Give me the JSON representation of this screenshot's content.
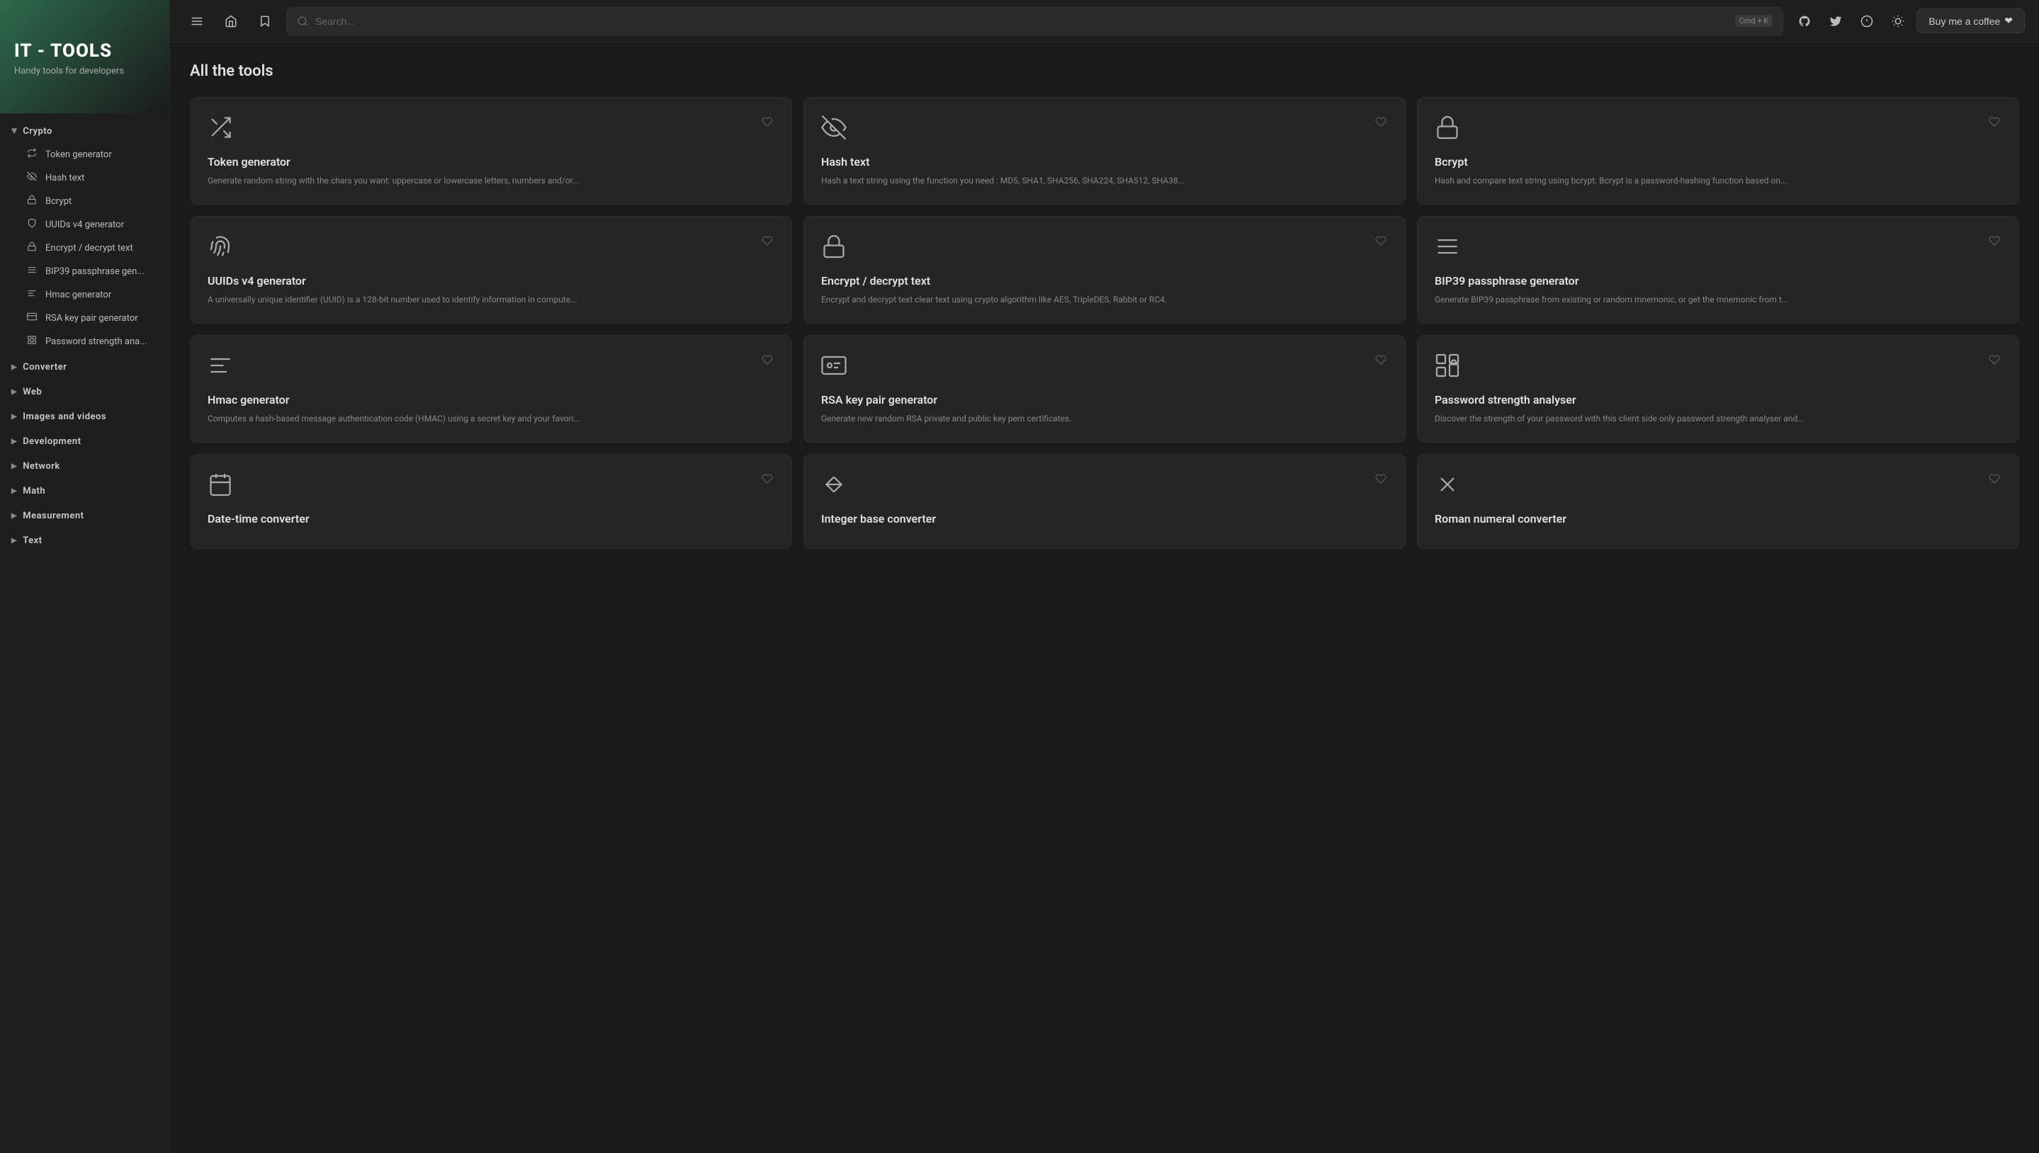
{
  "sidebar": {
    "title": "IT - TOOLS",
    "subtitle": "Handy tools for developers",
    "sections": [
      {
        "id": "crypto",
        "label": "Crypto",
        "open": true,
        "items": [
          {
            "id": "token-generator",
            "label": "Token generator",
            "icon": "⇄"
          },
          {
            "id": "hash-text",
            "label": "Hash text",
            "icon": "◎"
          },
          {
            "id": "bcrypt",
            "label": "Bcrypt",
            "icon": "▦"
          },
          {
            "id": "uuids-v4",
            "label": "UUIDs v4 generator",
            "icon": "◌"
          },
          {
            "id": "encrypt-decrypt",
            "label": "Encrypt / decrypt text",
            "icon": "🔒"
          },
          {
            "id": "bip39",
            "label": "BIP39 passphrase gen...",
            "icon": "≡"
          },
          {
            "id": "hmac",
            "label": "Hmac generator",
            "icon": "≡"
          },
          {
            "id": "rsa-key",
            "label": "RSA key pair generator",
            "icon": "▦"
          },
          {
            "id": "password-strength",
            "label": "Password strength ana...",
            "icon": "▦"
          }
        ]
      },
      {
        "id": "converter",
        "label": "Converter",
        "open": false,
        "items": []
      },
      {
        "id": "web",
        "label": "Web",
        "open": false,
        "items": []
      },
      {
        "id": "images-and-videos",
        "label": "Images and videos",
        "open": false,
        "items": []
      },
      {
        "id": "development",
        "label": "Development",
        "open": false,
        "items": []
      },
      {
        "id": "network",
        "label": "Network",
        "open": false,
        "items": []
      },
      {
        "id": "math",
        "label": "Math",
        "open": false,
        "items": []
      },
      {
        "id": "measurement",
        "label": "Measurement",
        "open": false,
        "items": []
      },
      {
        "id": "text",
        "label": "Text",
        "open": false,
        "items": []
      }
    ]
  },
  "topbar": {
    "search_placeholder": "Search...",
    "search_shortcut": "Cmd + K",
    "buy_coffee_label": "Buy me a coffee",
    "buy_coffee_icon": "☕"
  },
  "content": {
    "title": "All the tools",
    "tools": [
      {
        "id": "token-generator",
        "name": "Token generator",
        "desc": "Generate random string with the chars you want: uppercase or lowercase letters, numbers and/or...",
        "icon": "shuffle"
      },
      {
        "id": "hash-text",
        "name": "Hash text",
        "desc": "Hash a text string using the function you need : MD5, SHA1, SHA256, SHA224, SHA512, SHA38...",
        "icon": "eye-off"
      },
      {
        "id": "bcrypt",
        "name": "Bcrypt",
        "desc": "Hash and compare text string using bcrypt. Bcrypt is a password-hashing function based on...",
        "icon": "lock"
      },
      {
        "id": "uuids-v4",
        "name": "UUIDs v4 generator",
        "desc": "A universally unique identifier (UUID) is a 128-bit number used to identify information in compute...",
        "icon": "fingerprint"
      },
      {
        "id": "encrypt-decrypt",
        "name": "Encrypt / decrypt text",
        "desc": "Encrypt and decrypt text clear text using crypto algorithm like AES, TripleDES, Rabbit or RC4.",
        "icon": "lock"
      },
      {
        "id": "bip39",
        "name": "BIP39 passphrase generator",
        "desc": "Generate BIP39 passphrase from existing or random mnemonic, or get the mnemonic from t...",
        "icon": "menu"
      },
      {
        "id": "hmac",
        "name": "Hmac generator",
        "desc": "Computes a hash-based message authentication code (HMAC) using a secret key and your favori...",
        "icon": "menu-alt"
      },
      {
        "id": "rsa-key",
        "name": "RSA key pair generator",
        "desc": "Generate new random RSA private and public key pem certificates.",
        "icon": "id-card"
      },
      {
        "id": "password-strength",
        "name": "Password strength analyser",
        "desc": "Discover the strength of your password with this client side only password strength analyser and...",
        "icon": "grid-lock"
      },
      {
        "id": "date-time",
        "name": "Date-time converter",
        "desc": "",
        "icon": "calendar"
      },
      {
        "id": "integer-base",
        "name": "Integer base converter",
        "desc": "",
        "icon": "arrows-lr"
      },
      {
        "id": "roman-numeral",
        "name": "Roman numeral converter",
        "desc": "",
        "icon": "x-close"
      }
    ]
  }
}
